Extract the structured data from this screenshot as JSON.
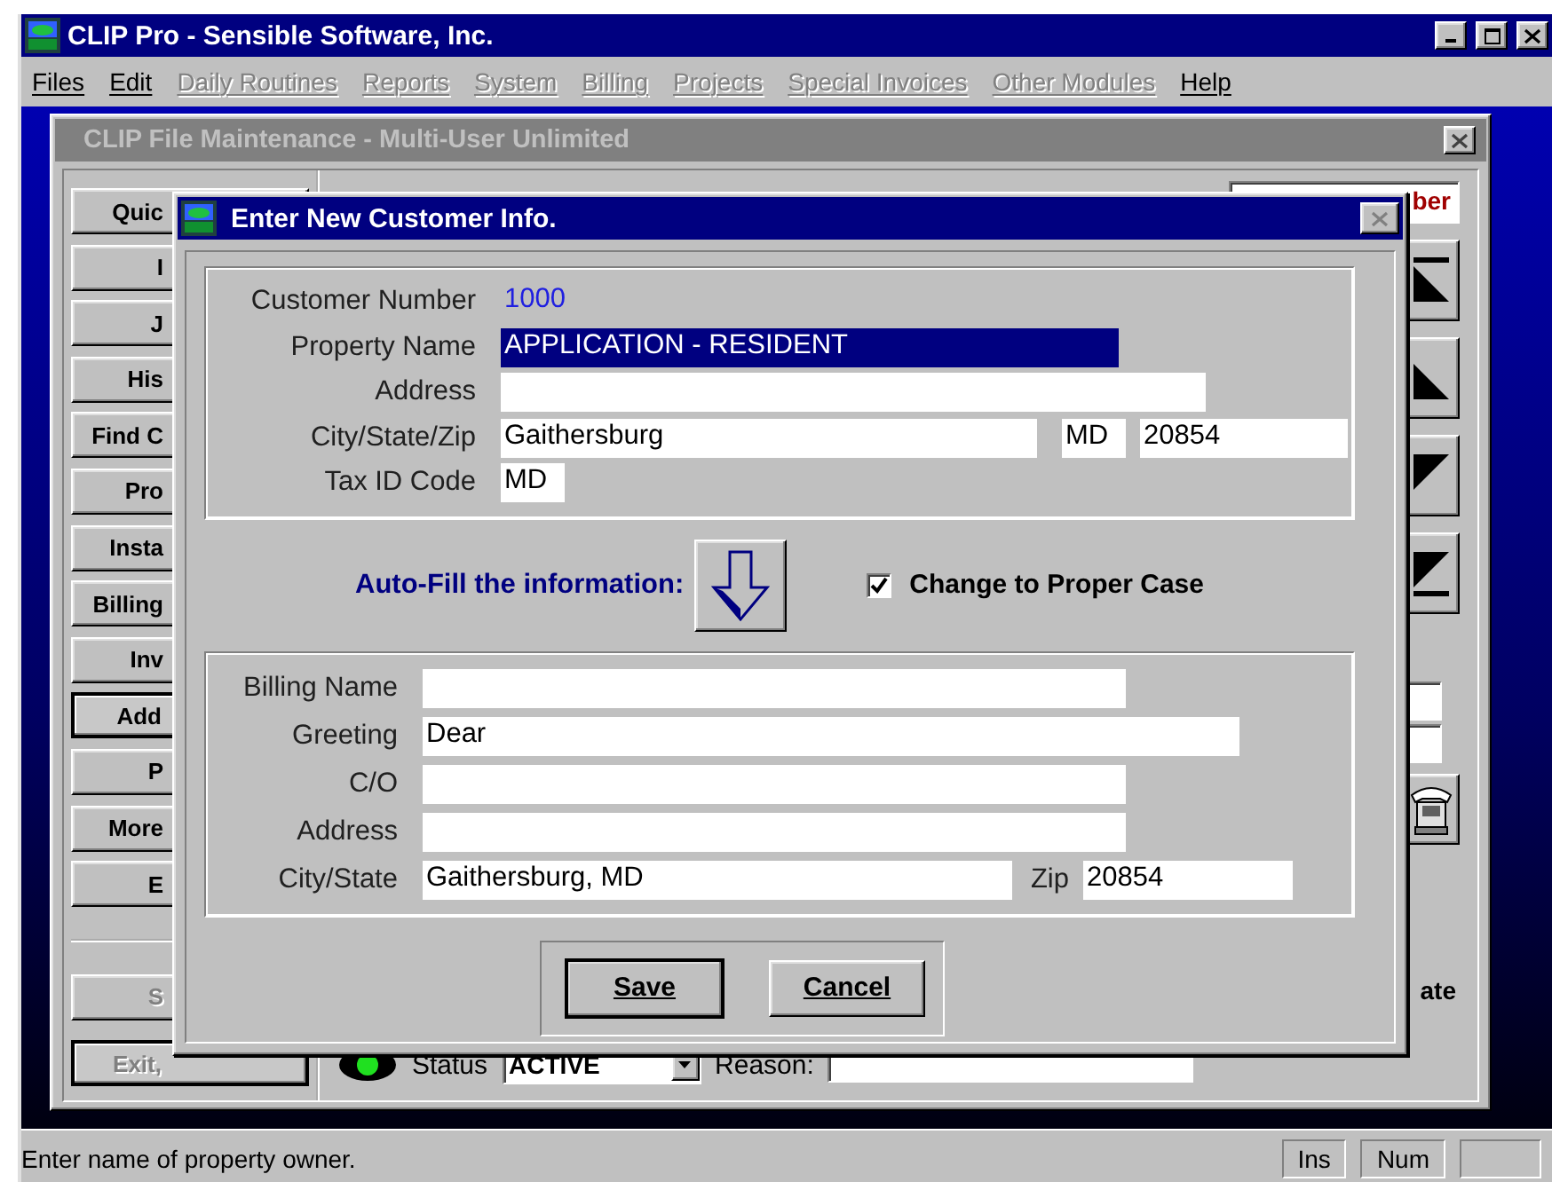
{
  "app_window": {
    "title": "CLIP Pro - Sensible Software, Inc."
  },
  "menu": [
    {
      "label": "Files",
      "disabled": false
    },
    {
      "label": "Edit",
      "disabled": false
    },
    {
      "label": "Daily Routines",
      "disabled": true
    },
    {
      "label": "Reports",
      "disabled": true
    },
    {
      "label": "System",
      "disabled": true
    },
    {
      "label": "Billing",
      "disabled": true
    },
    {
      "label": "Projects",
      "disabled": true
    },
    {
      "label": "Special Invoices",
      "disabled": true
    },
    {
      "label": "Other Modules",
      "disabled": true
    },
    {
      "label": "Help",
      "disabled": false
    }
  ],
  "child_window": {
    "title": "CLIP File Maintenance - Multi-User Unlimited",
    "side_buttons": [
      {
        "label": "Quic",
        "focused": false
      },
      {
        "label": "I",
        "focused": false
      },
      {
        "label": "J",
        "focused": false
      },
      {
        "label": "His",
        "focused": false
      },
      {
        "label": "Find C",
        "focused": false
      },
      {
        "label": "Pro",
        "focused": false
      },
      {
        "label": "Insta",
        "focused": false
      },
      {
        "label": "Billing",
        "focused": false
      },
      {
        "label": "Inv",
        "focused": false
      },
      {
        "label": "Add",
        "focused": true
      },
      {
        "label": "P",
        "focused": false
      },
      {
        "label": "More",
        "focused": false
      },
      {
        "label": "E",
        "focused": false
      }
    ],
    "lower_buttons": [
      {
        "label": "S",
        "disabled": true,
        "default": false
      },
      {
        "label": "Exit,",
        "disabled": true,
        "default": true
      }
    ],
    "header_box": "ber",
    "nav_buttons": [
      {
        "kind": "first"
      },
      {
        "kind": "prev"
      },
      {
        "kind": "next"
      },
      {
        "kind": "last"
      }
    ],
    "side_label": "ate",
    "status_label": "Status",
    "status_value": "ACTIVE",
    "reason_label": "Reason:"
  },
  "dialog": {
    "title": "Enter New Customer Info.",
    "upper_rows": [
      {
        "label": "Customer Number",
        "fields": [
          {
            "kind": "plain",
            "value": "1000"
          }
        ]
      },
      {
        "label": "Property Name",
        "fields": [
          {
            "kind": "highlighted",
            "value": "APPLICATION - RESIDENT"
          }
        ]
      },
      {
        "label": "Address",
        "fields": [
          {
            "kind": "input"
          }
        ]
      },
      {
        "label": "City/State/Zip",
        "fields": [
          {
            "kind": "input",
            "value": "Gaithersburg"
          },
          {
            "kind": "input",
            "value": "MD"
          },
          {
            "kind": "input",
            "value": "20854"
          }
        ]
      },
      {
        "label": "Tax ID Code",
        "fields": [
          {
            "kind": "input",
            "value": "MD"
          }
        ]
      }
    ],
    "autofill_label": "Auto-Fill the information:",
    "proper_case": {
      "label": "Change to Proper Case",
      "checked": true
    },
    "lower_rows": [
      {
        "label": "Billing Name"
      },
      {
        "label": "Greeting",
        "value": "Dear"
      },
      {
        "label": "C/O"
      },
      {
        "label": "Address"
      },
      {
        "label": "City/State",
        "value": "Gaithersburg, MD",
        "extra_label": "Zip",
        "extra_value": "20854"
      }
    ],
    "buttons": [
      {
        "label": "Save",
        "default": true
      },
      {
        "label": "Cancel",
        "default": false
      }
    ]
  },
  "status_bar": {
    "message": "Enter name of property owner.",
    "panes": [
      "Ins",
      "Num"
    ]
  }
}
